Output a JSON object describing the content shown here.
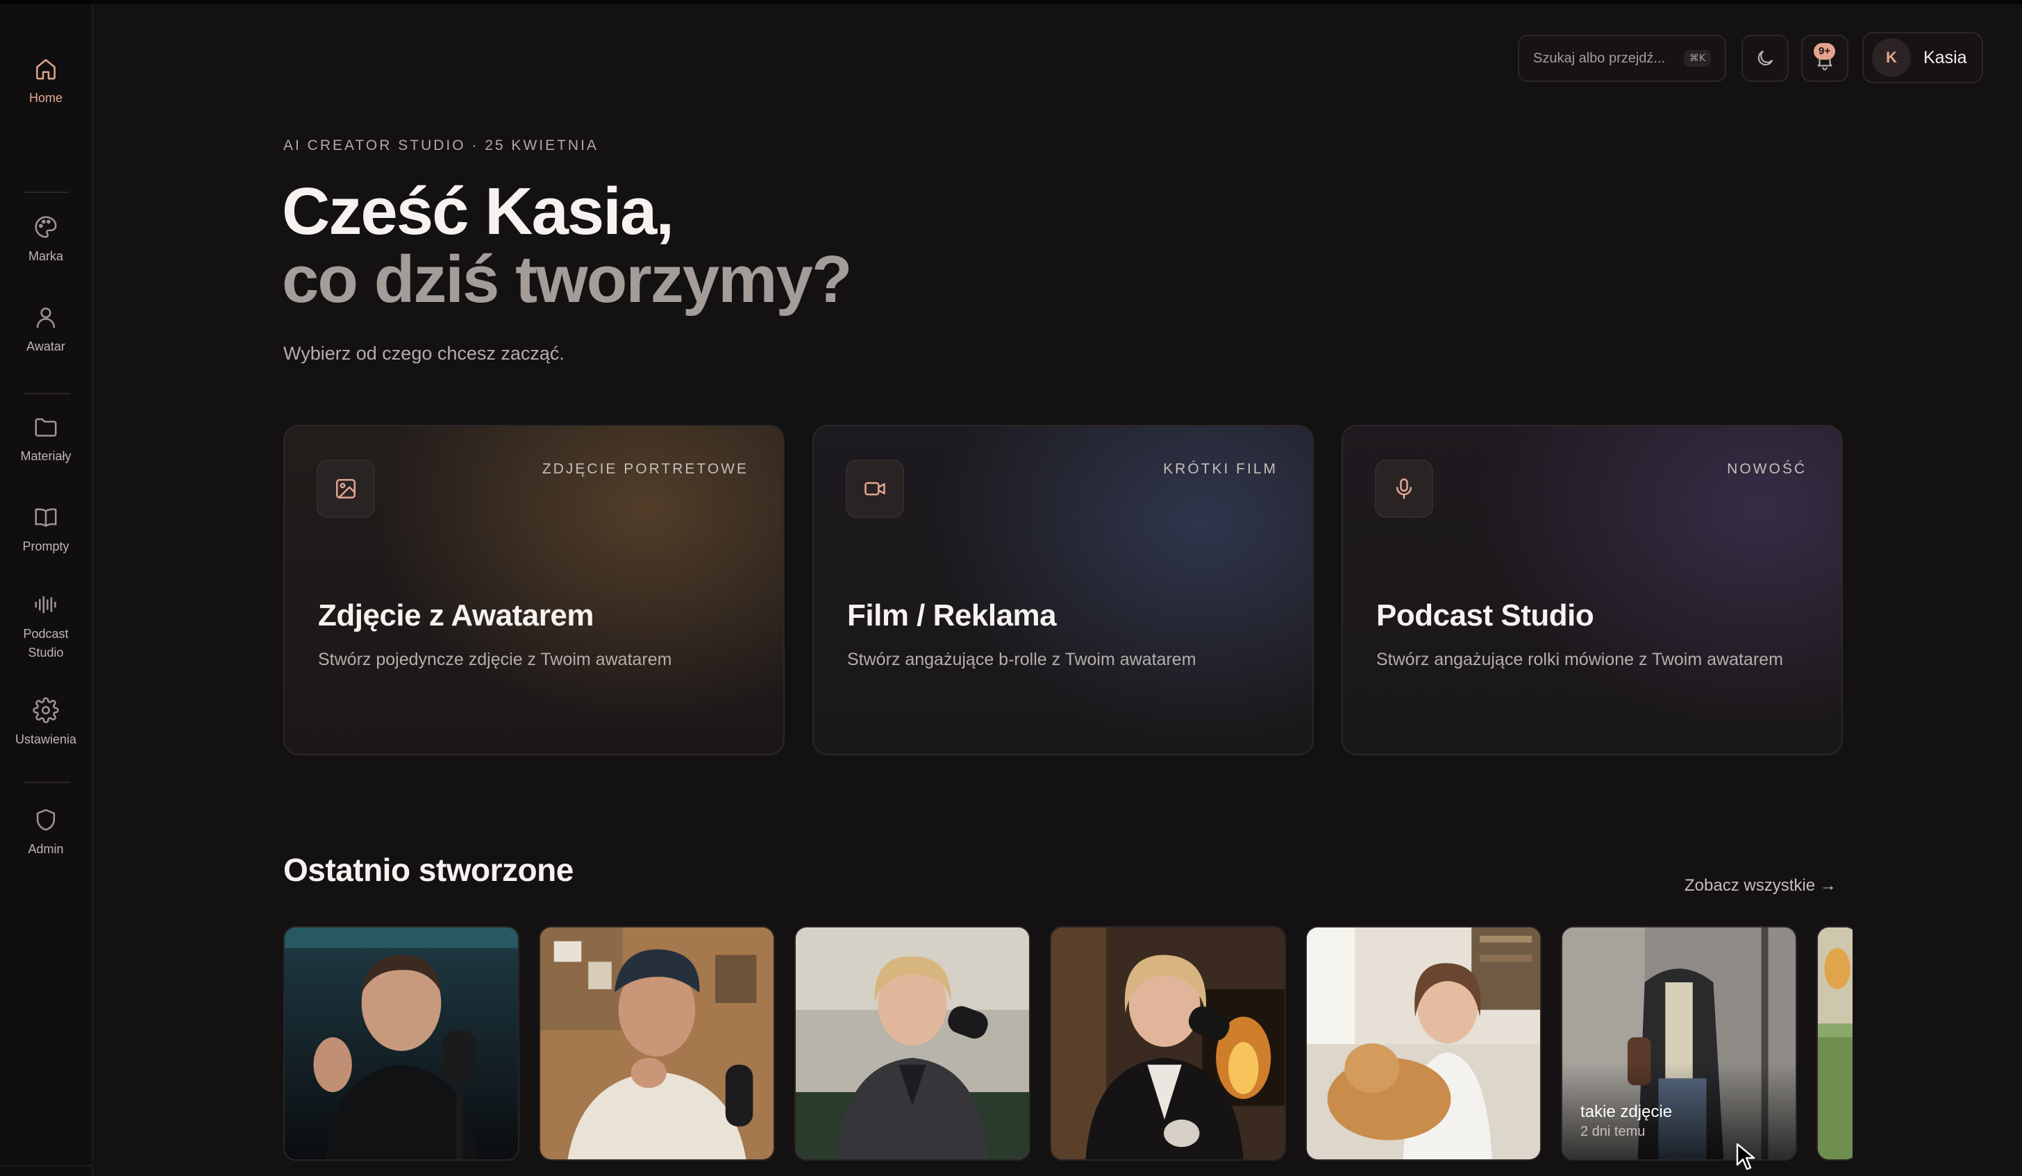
{
  "sidebar": {
    "items": [
      {
        "label": "Home",
        "icon": "home-icon"
      },
      {
        "label": "Marka",
        "icon": "palette-icon"
      },
      {
        "label": "Awatar",
        "icon": "user-icon"
      },
      {
        "label": "Materiały",
        "icon": "folder-icon"
      },
      {
        "label": "Prompty",
        "icon": "book-icon"
      },
      {
        "label": "Podcast Studio",
        "icon": "waveform-icon"
      },
      {
        "label": "Ustawienia",
        "icon": "gear-icon"
      },
      {
        "label": "Admin",
        "icon": "shield-icon"
      }
    ]
  },
  "topbar": {
    "search_placeholder": "Szukaj albo przejdź...",
    "search_shortcut": "⌘K",
    "notifications_badge": "9+",
    "user_initial": "K",
    "user_name": "Kasia"
  },
  "hero": {
    "eyebrow": "AI CREATOR STUDIO · 25 KWIETNIA",
    "title_line1": "Cześć Kasia,",
    "title_line2": "co dziś tworzymy?",
    "subtitle": "Wybierz od czego chcesz zacząć."
  },
  "cards": [
    {
      "tag": "ZDJĘCIE PORTRETOWE",
      "title": "Zdjęcie z Awatarem",
      "description": "Stwórz pojedyncze zdjęcie z Twoim awatarem",
      "icon": "image-icon"
    },
    {
      "tag": "KRÓTKI FILM",
      "title": "Film / Reklama",
      "description": "Stwórz angażujące b-rolle z Twoim awatarem",
      "icon": "video-camera-icon"
    },
    {
      "tag": "NOWOŚĆ",
      "title": "Podcast Studio",
      "description": "Stwórz angażujące rolki mówione z Twoim awatarem",
      "icon": "microphone-icon"
    }
  ],
  "recent": {
    "title": "Ostatnio stworzone",
    "see_all": "Zobacz wszystkie →",
    "hovered_item": {
      "title": "takie zdjęcie",
      "time": "2 dni temu"
    }
  },
  "colors": {
    "accent": "#e3aa90",
    "background": "#141112"
  }
}
